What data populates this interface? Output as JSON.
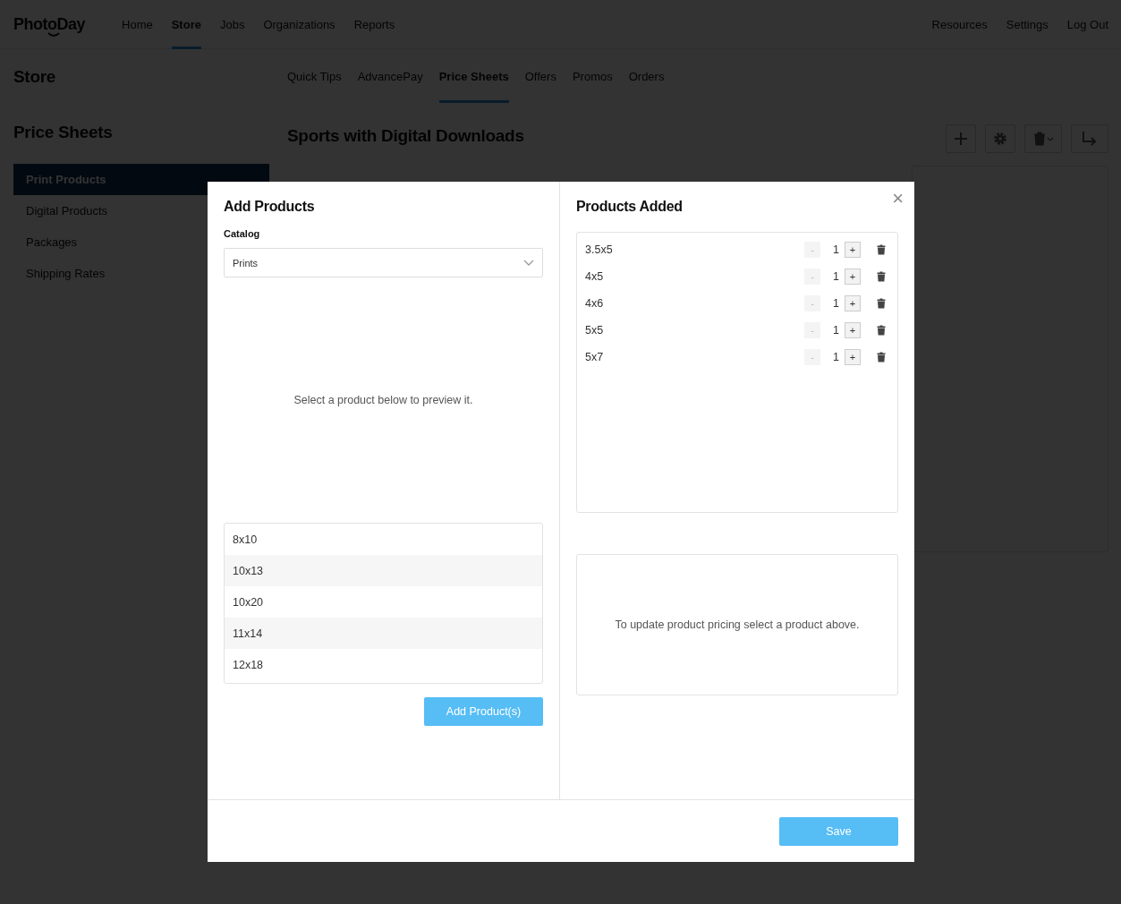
{
  "brand": "PhotoDay",
  "nav": [
    {
      "label": "Home",
      "selected": false
    },
    {
      "label": "Store",
      "selected": true
    },
    {
      "label": "Jobs",
      "selected": false
    },
    {
      "label": "Organizations",
      "selected": false
    },
    {
      "label": "Reports",
      "selected": false
    }
  ],
  "nav_right": [
    "Resources",
    "Settings",
    "Log Out"
  ],
  "section_title": "Store",
  "subtabs": [
    {
      "label": "Quick Tips",
      "selected": false
    },
    {
      "label": "AdvancePay",
      "selected": false
    },
    {
      "label": "Price Sheets",
      "selected": true
    },
    {
      "label": "Offers",
      "selected": false
    },
    {
      "label": "Promos",
      "selected": false
    },
    {
      "label": "Orders",
      "selected": false
    }
  ],
  "sidebar": {
    "title": "Price Sheets",
    "items": [
      {
        "label": "Print Products",
        "selected": true
      },
      {
        "label": "Digital Products",
        "selected": false
      },
      {
        "label": "Packages",
        "selected": false
      },
      {
        "label": "Shipping Rates",
        "selected": false
      }
    ]
  },
  "page_title": "Sports with Digital Downloads",
  "modal": {
    "close": "×",
    "left": {
      "title": "Add Products",
      "catalog_label": "Catalog",
      "catalog_value": "Prints",
      "preview_hint": "Select a product below to preview it.",
      "products": [
        "8x10",
        "10x13",
        "10x20",
        "11x14",
        "12x18"
      ],
      "add_button": "Add Product(s)"
    },
    "right": {
      "title": "Products Added",
      "items": [
        {
          "name": "3.5x5",
          "quantity": "1",
          "minus": "-",
          "plus": "+",
          "minus_disabled": true
        },
        {
          "name": "4x5",
          "quantity": "1",
          "minus": "-",
          "plus": "+",
          "minus_disabled": true
        },
        {
          "name": "4x6",
          "quantity": "1",
          "minus": "-",
          "plus": "+",
          "minus_disabled": true
        },
        {
          "name": "5x5",
          "quantity": "1",
          "minus": "-",
          "plus": "+",
          "minus_disabled": true
        },
        {
          "name": "5x7",
          "quantity": "1",
          "minus": "-",
          "plus": "+",
          "minus_disabled": true
        }
      ],
      "pricing_hint": "To update product pricing select a product above."
    },
    "save_button": "Save"
  }
}
